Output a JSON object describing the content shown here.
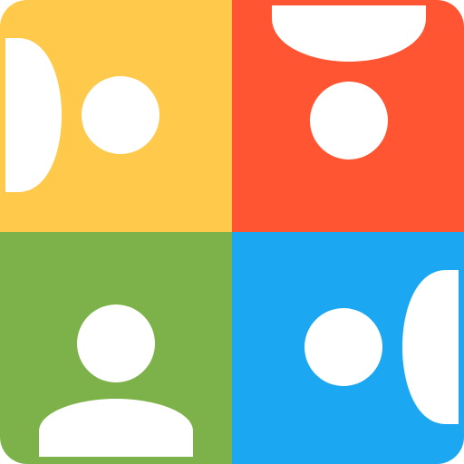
{
  "icon": {
    "name": "people-video-grid-app-icon",
    "colors": {
      "yellow": "#FFC94B",
      "red": "#FF5532",
      "green": "#7DB24B",
      "blue": "#1BA7F2",
      "figure": "#FFFFFF"
    },
    "tiles": [
      {
        "position": "top-left",
        "color": "yellow",
        "figure": "person-rotated-left"
      },
      {
        "position": "top-right",
        "color": "red",
        "figure": "person-upside-down"
      },
      {
        "position": "bottom-left",
        "color": "green",
        "figure": "person-upright"
      },
      {
        "position": "bottom-right",
        "color": "blue",
        "figure": "person-rotated-right"
      }
    ]
  }
}
